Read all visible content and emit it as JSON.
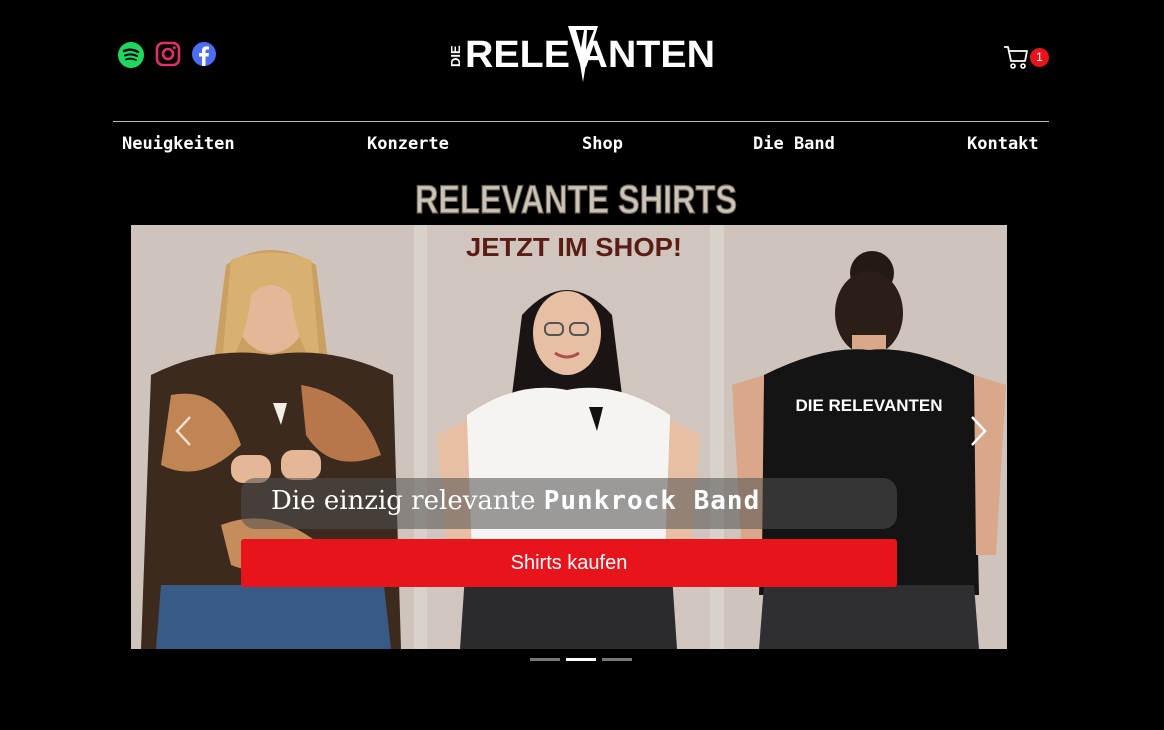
{
  "header": {
    "social": [
      {
        "name": "spotify-icon",
        "color": "#1ed760"
      },
      {
        "name": "instagram-icon",
        "color": "#e1306c"
      },
      {
        "name": "facebook-icon",
        "color": "#4c6ef5"
      }
    ],
    "logo": {
      "text_die": "DIE",
      "text_main": "RELEVANTEN"
    },
    "cart": {
      "icon": "cart-icon",
      "count": "1"
    }
  },
  "nav": {
    "items": [
      "Neuigkeiten",
      "Konzerte",
      "Shop",
      "Die Band",
      "Kontakt"
    ]
  },
  "carousel": {
    "title": "RELEVANTE SHIRTS",
    "subtitle": "JETZT IM SHOP!",
    "caption_prefix": "Die einzig relevante",
    "caption_highlight": "Punkrock Band",
    "button_label": "Shirts kaufen",
    "shirt_print": "DIE RELEVANTEN",
    "active_index": 1,
    "slide_count": 3,
    "accent_color": "#e8141b"
  }
}
